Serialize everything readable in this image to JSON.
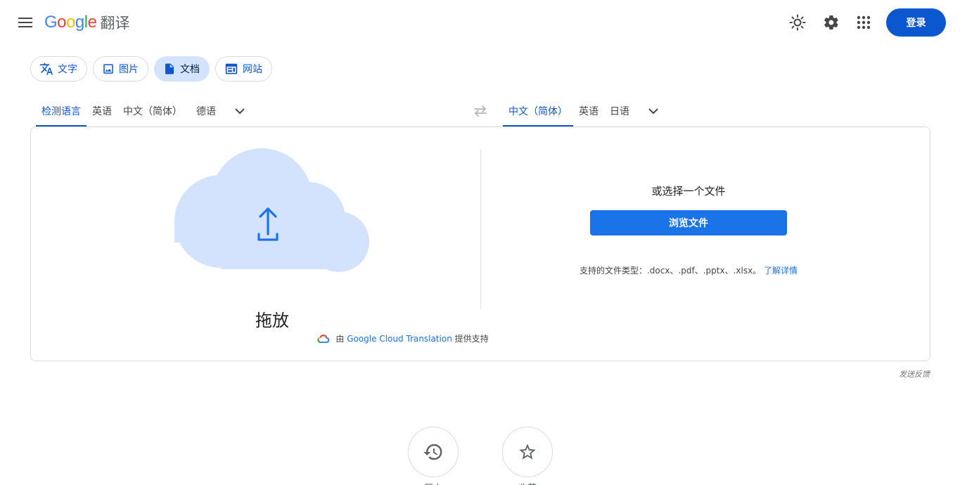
{
  "header": {
    "logo_letters": [
      "G",
      "o",
      "o",
      "g",
      "l",
      "e"
    ],
    "logo_colors": [
      "#4285f4",
      "#ea4335",
      "#fbbc05",
      "#4285f4",
      "#34a853",
      "#ea4335"
    ],
    "product_name": "翻译",
    "signin_label": "登录",
    "icons": [
      "menu-icon",
      "theme-icon",
      "settings-icon",
      "apps-icon"
    ]
  },
  "modes": [
    {
      "label": "文字",
      "icon": "translate-icon",
      "active": false
    },
    {
      "label": "图片",
      "icon": "image-icon",
      "active": false
    },
    {
      "label": "文档",
      "icon": "document-icon",
      "active": true
    },
    {
      "label": "网站",
      "icon": "website-icon",
      "active": false
    }
  ],
  "source_languages": [
    "检测语言",
    "英语",
    "中文（简体）",
    "德语"
  ],
  "source_active_index": 0,
  "target_languages": [
    "中文（简体）",
    "英语",
    "日语"
  ],
  "target_active_index": 0,
  "upload": {
    "drop_label": "拖放",
    "or_choose": "或选择一个文件",
    "browse_label": "浏览文件",
    "supported_text": "支持的文件类型：.docx、.pdf、.pptx、.xlsx。",
    "learn_more": "了解详情"
  },
  "powered_by": {
    "prefix": "由",
    "link": "Google Cloud Translation",
    "suffix": "提供支持"
  },
  "feedback_label": "发送反馈",
  "bottom_buttons": [
    {
      "icon": "history-icon",
      "label": "历史"
    },
    {
      "icon": "star-icon",
      "label": "收藏"
    }
  ],
  "colors": {
    "accent": "#0b57d0",
    "browse": "#1a73e8",
    "active_chip_bg": "#d3e3fd",
    "cloud": "#d3e3fd"
  }
}
